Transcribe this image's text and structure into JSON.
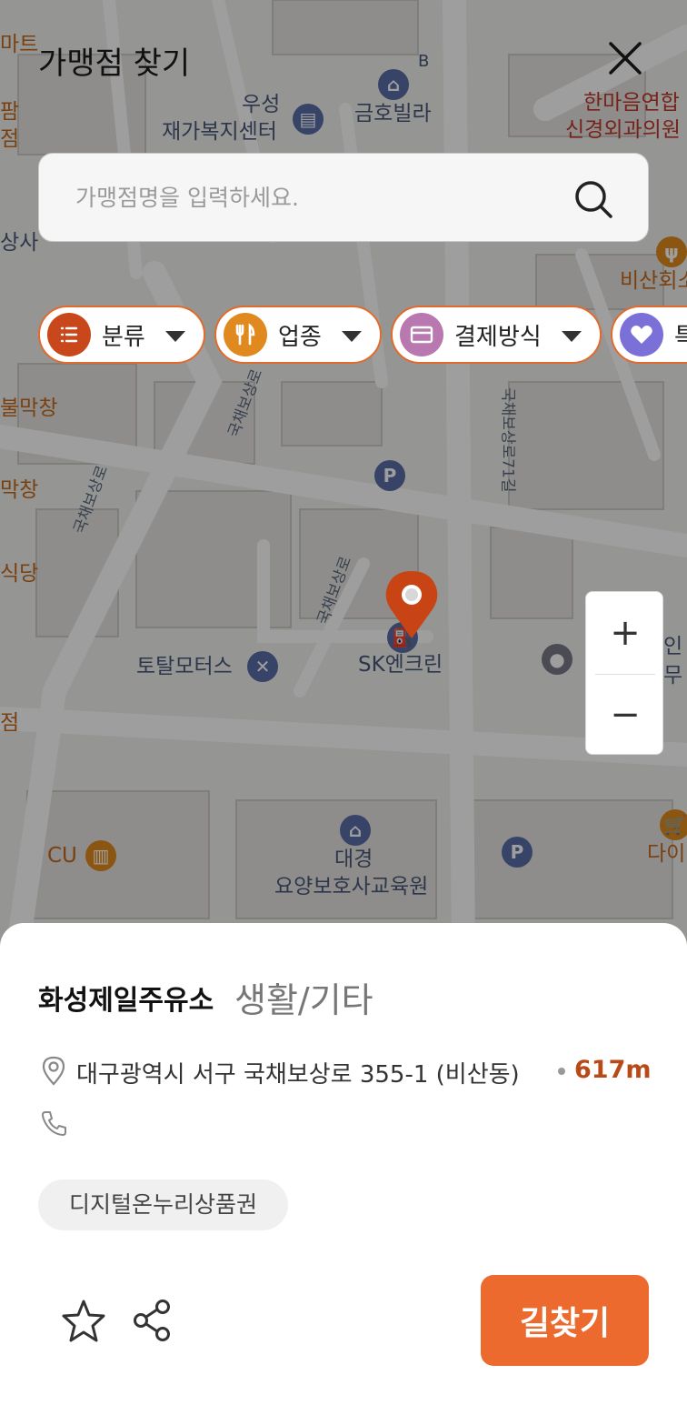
{
  "header": {
    "title": "가맹점 찾기",
    "close_icon": "close-icon"
  },
  "search": {
    "placeholder": "가맹점명을 입력하세요.",
    "value": "",
    "icon": "search-icon"
  },
  "filters": [
    {
      "label": "분류",
      "icon": "list-icon",
      "icon_color": "#c8481b"
    },
    {
      "label": "업종",
      "icon": "utensils-icon",
      "icon_color": "#e0891e"
    },
    {
      "label": "결제방식",
      "icon": "card-icon",
      "icon_color": "#b978b0"
    },
    {
      "label": "특",
      "icon": "heart-icon",
      "icon_color": "#7a70d8"
    }
  ],
  "map_labels": {
    "mart": "마트",
    "left_1": "팜",
    "left_2": "점",
    "left_sang": "상사",
    "welfare_1": "우성",
    "welfare_2": "재가복지센터",
    "villa": "금호빌라",
    "villa_b": "B",
    "clinic_1": "한마음연합",
    "clinic_2": "신경외과의원",
    "bisan": "비산회소",
    "bulmak": "불막창",
    "makchang": "막창",
    "sikdang": "식당",
    "gukchae_71": "국채보상로71길",
    "street_left": "국채보상로",
    "street_mid": "국채보상로",
    "street_pin": "국채보상로",
    "totalmotors": "토탈모터스",
    "sk": "SK엔크린",
    "right_in": "인",
    "right_mu": "무",
    "jeom_bottom": "점",
    "cu": "CU",
    "daegyeong_1": "대경",
    "daegyeong_2": "요양보호사교육원",
    "right_dai": "다이"
  },
  "zoom": {
    "in": "+",
    "out": "−"
  },
  "store": {
    "name": "화성제일주유소",
    "category": "생활/기타",
    "address": "대구광역시 서구 국채보상로 355-1 (비산동)",
    "distance": "617m",
    "phone": "",
    "tag": "디지털온누리상품권",
    "favorite_icon": "star-icon",
    "share_icon": "share-icon",
    "route_label": "길찾기"
  },
  "colors": {
    "accent": "#ed6a2f",
    "chip_border": "#e26a2c",
    "distance": "#b84a18",
    "marker": "#c84414"
  }
}
